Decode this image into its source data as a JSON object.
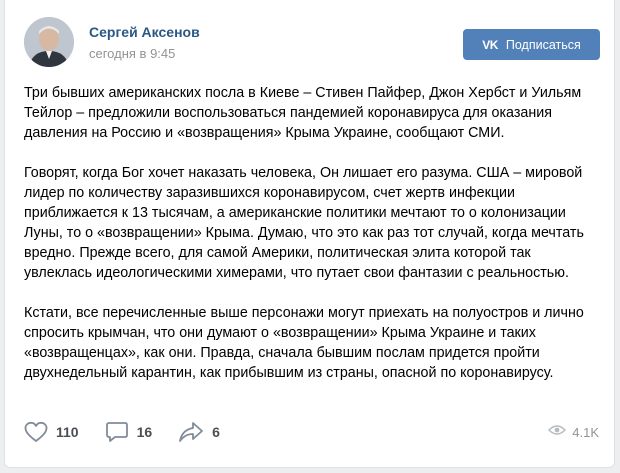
{
  "author": {
    "name": "Сергей Аксенов",
    "time": "сегодня в 9:45"
  },
  "subscribe": {
    "logo": "VK",
    "label": "Подписаться"
  },
  "post": {
    "paragraphs": [
      "Три бывших американских посла в Киеве – Стивен Пайфер, Джон Хербст и Уильям Тейлор – предложили воспользоваться пандемией коронавируса для оказания давления на Россию и «возвращения» Крыма Украине, сообщают СМИ.",
      "Говорят, когда Бог хочет наказать человека, Он лишает его разума. США – мировой лидер по количеству заразившихся коронавирусом, счет жертв инфекции приближается к 13 тысячам, а американские политики мечтают то о колонизации Луны, то о «возвращении» Крыма. Думаю, что это как раз тот случай, когда мечтать вредно. Прежде всего, для самой Америки, политическая элита которой так увлеклась идеологическими химерами, что путает свои фантазии с реальностью.",
      "Кстати, все перечисленные выше персонажи могут приехать на полуостров и лично спросить крымчан, что они думают о «возвращении» Крыма Украине и таких «возвращенцах», как они. Правда, сначала бывшим послам придется пройти двухнедельный карантин, как прибывшим из страны, опасной по коронавирусу."
    ]
  },
  "actions": {
    "likes": "110",
    "comments": "16",
    "shares": "6",
    "views": "4.1K"
  },
  "icons": [
    "heart-icon",
    "comment-icon",
    "share-icon",
    "eye-icon"
  ],
  "colors": {
    "accent": "#5181b8",
    "name": "#2a5885",
    "muted": "#939393"
  }
}
